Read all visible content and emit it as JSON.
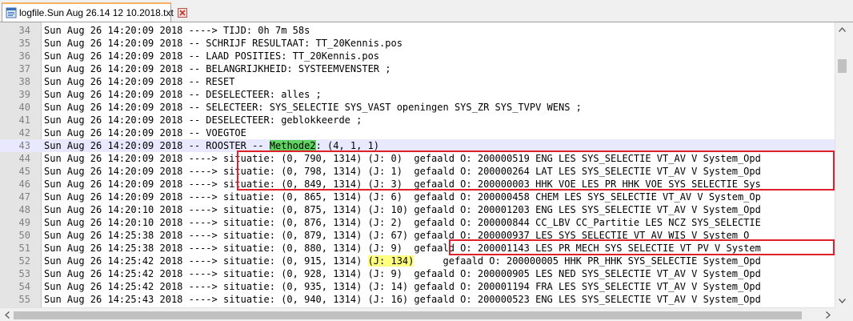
{
  "tab": {
    "label": "logfile.Sun Aug 26.14 12 10.2018.txt",
    "icon": "text-file-icon",
    "close_icon": "close-icon",
    "accent": "#fab15f"
  },
  "colors": {
    "current_line": "#e8e8ff",
    "highlight_green": "#5fd35f",
    "highlight_yellow": "#ffff7f",
    "annotation_red": "#e0202a"
  },
  "lines": [
    {
      "num": "34",
      "text": "Sun Aug 26 14:20:09 2018 ----> TIJD: 0h 7m 58s"
    },
    {
      "num": "35",
      "text": "Sun Aug 26 14:20:09 2018 -- SCHRIJF RESULTAAT: TT_20Kennis.pos"
    },
    {
      "num": "36",
      "text": "Sun Aug 26 14:20:09 2018 -- LAAD POSITIES: TT_20Kennis.pos"
    },
    {
      "num": "37",
      "text": "Sun Aug 26 14:20:09 2018 -- BELANGRIJKHEID: SYSTEEMVENSTER ;"
    },
    {
      "num": "38",
      "text": "Sun Aug 26 14:20:09 2018 -- RESET"
    },
    {
      "num": "39",
      "text": "Sun Aug 26 14:20:09 2018 -- DESELECTEER: alles ;"
    },
    {
      "num": "40",
      "text": "Sun Aug 26 14:20:09 2018 -- SELECTEER: SYS_SELECTIE SYS_VAST openingen SYS_ZR SYS_TVPV WENS ;"
    },
    {
      "num": "41",
      "text": "Sun Aug 26 14:20:09 2018 -- DESELECTEER: geblokkeerde ;"
    },
    {
      "num": "42",
      "text": "Sun Aug 26 14:20:09 2018 -- VOEGTOE"
    },
    {
      "num": "43",
      "pre": "Sun Aug 26 14:20:09 2018 -- ROOSTER -- ",
      "hl": "Methode2",
      "post": ": (4, 1, 1)"
    },
    {
      "num": "44",
      "text": "Sun Aug 26 14:20:09 2018 ----> situatie: (0, 790, 1314) (J: 0)  gefaald O: 200000519 ENG LES SYS_SELECTIE VT_AV V System_Opd"
    },
    {
      "num": "45",
      "text": "Sun Aug 26 14:20:09 2018 ----> situatie: (0, 798, 1314) (J: 1)  gefaald O: 200000264 LAT LES SYS_SELECTIE VT_AV V System_Opd"
    },
    {
      "num": "46",
      "text": "Sun Aug 26 14:20:09 2018 ----> situatie: (0, 849, 1314) (J: 3)  gefaald O: 200000003 HHK VOE LES PR HHK VOE SYS SELECTIE Sys"
    },
    {
      "num": "47",
      "text": "Sun Aug 26 14:20:09 2018 ----> situatie: (0, 865, 1314) (J: 6)  gefaald O: 200000458 CHEM LES SYS_SELECTIE VT_AV V System_Op"
    },
    {
      "num": "48",
      "text": "Sun Aug 26 14:20:10 2018 ----> situatie: (0, 875, 1314) (J: 10) gefaald O: 200001203 ENG LES SYS_SELECTIE VT_AV V System_Opd"
    },
    {
      "num": "49",
      "text": "Sun Aug 26 14:20:10 2018 ----> situatie: (0, 876, 1314) (J: 2)  gefaald O: 200000844 CC_LBV CC_Partitie LES NCZ SYS_SELECTIE"
    },
    {
      "num": "50",
      "text": "Sun Aug 26 14:25:38 2018 ----> situatie: (0, 879, 1314) (J: 67) gefaald O: 200000937 LES SYS_SELECTIE VT_AV WIS V System_O"
    },
    {
      "num": "51",
      "text": "Sun Aug 26 14:25:38 2018 ----> situatie: (0, 880, 1314) (J: 9)  gefaald O: 200001143 LES PR MECH SYS SELECTIE VT PV V System"
    },
    {
      "num": "52",
      "pre": "Sun Aug 26 14:25:42 2018 ----> situatie: (0, 915, 1314) ",
      "hl": "(J: 134)",
      "post": "     gefaald O: 200000005 HHK PR_HHK SYS_SELECTIE System_Opd"
    },
    {
      "num": "53",
      "text": "Sun Aug 26 14:25:42 2018 ----> situatie: (0, 928, 1314) (J: 9)  gefaald O: 200000905 LES NED SYS_SELECTIE VT_AV V System_Opd"
    },
    {
      "num": "54",
      "text": "Sun Aug 26 14:25:42 2018 ----> situatie: (0, 935, 1314) (J: 14) gefaald O: 200001194 FRA LES SYS_SELECTIE VT_AV V System_Opd"
    },
    {
      "num": "55",
      "text": "Sun Aug 26 14:25:43 2018 ----> situatie: (0, 940, 1314) (J: 16) gefaald O: 200000523 ENG LES SYS_SELECTIE VT_AV V System_Opd"
    }
  ]
}
